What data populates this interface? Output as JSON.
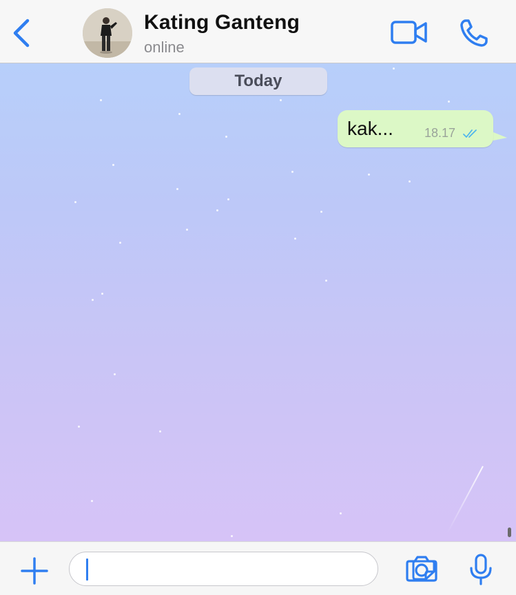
{
  "header": {
    "contact_name": "Kating Ganteng",
    "contact_status": "online",
    "icons": {
      "back": "chevron-left-icon",
      "video": "video-camera-icon",
      "call": "phone-icon"
    }
  },
  "chat": {
    "date_label": "Today",
    "messages": [
      {
        "text": "kak...",
        "time": "18.17",
        "direction": "outgoing",
        "status": "read-double-tick"
      }
    ]
  },
  "composer": {
    "input_value": "",
    "icons": {
      "attach": "plus-icon",
      "sticker": "sticker-icon",
      "camera": "camera-icon",
      "mic": "microphone-icon"
    }
  },
  "colors": {
    "accent": "#2f7ef0",
    "bubble_outgoing": "#dcf8c6",
    "read_tick": "#4fb6ec"
  }
}
